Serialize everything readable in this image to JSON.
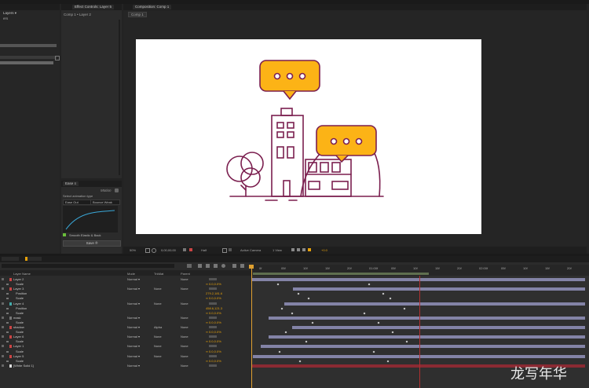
{
  "left_panel": {
    "tab_label": "Layers ▾",
    "sub_label": "ers"
  },
  "effect_panel": {
    "tab_label": "Effect Controls: Layer 5",
    "breadcrumb": "Comp 1 • Layer 2"
  },
  "ease_panel": {
    "tab_label": "Ease ≡",
    "brand": "Motion",
    "select_label": "Select animation type",
    "dropdown_1": "Ease Out",
    "dropdown_2": "Bounce Weak",
    "checkbox_label": "Smooth Elastic & Back",
    "save_button": "Save ®"
  },
  "composition": {
    "tab_label": "Composition: Comp 1",
    "comp_tab": "Comp 1",
    "footer": {
      "zoom": "50%",
      "timecode": "0;00;00;00",
      "resolution": "Half",
      "camera": "Active Camera",
      "views": "1 View",
      "exposure": "+0.0"
    }
  },
  "timeline": {
    "headers": {
      "layer_name": "Layer Name",
      "mode": "Mode",
      "trkmat": "TrkMat",
      "parent": "Parent"
    },
    "time_ticks": [
      "0f",
      "05f",
      "10f",
      "15f",
      "20f",
      "01:00f",
      "05f",
      "10f",
      "15f",
      "20f",
      "02:00f",
      "05f",
      "10f",
      "15f",
      "20f"
    ],
    "rows": [
      {
        "name": "Layer 2",
        "type": "layer",
        "mode": "Normal ▾",
        "trk": "",
        "parent": "None",
        "val": "",
        "bar": [
          320,
          745
        ],
        "bcolor": "#8383a6"
      },
      {
        "name": "Scale",
        "type": "prop",
        "mode": "",
        "trk": "",
        "parent": "",
        "val": "∞ 0.0,0.0%",
        "bar": null
      },
      {
        "name": "Layer 3",
        "type": "layer",
        "mode": "Normal ▾",
        "trk": "None",
        "parent": "None",
        "val": "",
        "bar": [
          373,
          745
        ],
        "bcolor": "#8383a6"
      },
      {
        "name": "Position",
        "type": "prop",
        "mode": "",
        "trk": "",
        "parent": "",
        "val": "279.2,181.6",
        "bar": null
      },
      {
        "name": "Scale",
        "type": "prop",
        "mode": "",
        "trk": "",
        "parent": "",
        "val": "∞ 0.0,0.0%",
        "bar": null
      },
      {
        "name": "Layer 4",
        "type": "layer",
        "mode": "Normal ▾",
        "trk": "None",
        "parent": "None",
        "val": "",
        "bar": [
          362,
          745
        ],
        "bcolor": "#8383a6"
      },
      {
        "name": "Position",
        "type": "prop",
        "mode": "",
        "trk": "",
        "parent": "",
        "val": "458.6,121.3",
        "bar": null
      },
      {
        "name": "Scale",
        "type": "prop",
        "mode": "",
        "trk": "",
        "parent": "",
        "val": "∞ 0.0,0.0%",
        "bar": null
      },
      {
        "name": "mask",
        "type": "layer",
        "mode": "Normal ▾",
        "trk": "",
        "parent": "None",
        "val": "",
        "bar": [
          342,
          745
        ],
        "bcolor": "#8383a6"
      },
      {
        "name": "Scale",
        "type": "prop",
        "mode": "",
        "trk": "",
        "parent": "",
        "val": "∞ 0.0,0.0%",
        "bar": null
      },
      {
        "name": "shadow",
        "type": "layer",
        "mode": "Normal ▾",
        "trk": "Alpha",
        "parent": "None",
        "val": "",
        "bar": [
          372,
          745
        ],
        "bcolor": "#8383a6"
      },
      {
        "name": "Scale",
        "type": "prop",
        "mode": "",
        "trk": "",
        "parent": "",
        "val": "∞ 0.0,0.0%",
        "bar": null
      },
      {
        "name": "Layer 6",
        "type": "layer",
        "mode": "Normal ▾",
        "trk": "None",
        "parent": "None",
        "val": "",
        "bar": [
          342,
          745
        ],
        "bcolor": "#8383a6"
      },
      {
        "name": "Scale",
        "type": "prop",
        "mode": "",
        "trk": "",
        "parent": "",
        "val": "∞ 0.0,0.0%",
        "bar": null
      },
      {
        "name": "Layer 1",
        "type": "layer",
        "mode": "Normal ▾",
        "trk": "None",
        "parent": "None",
        "val": "",
        "bar": [
          332,
          745
        ],
        "bcolor": "#8383a6"
      },
      {
        "name": "Scale",
        "type": "prop",
        "mode": "",
        "trk": "",
        "parent": "",
        "val": "∞ 0.0,0.0%",
        "bar": null
      },
      {
        "name": "Layer 5",
        "type": "layer",
        "mode": "Normal ▾",
        "trk": "None",
        "parent": "None",
        "val": "",
        "bar": [
          322,
          745
        ],
        "bcolor": "#8383a6"
      },
      {
        "name": "Scale",
        "type": "prop",
        "mode": "",
        "trk": "",
        "parent": "",
        "val": "∞ 0.0,0.0%",
        "bar": null
      },
      {
        "name": "[White Solid 1]",
        "type": "layer",
        "mode": "Normal ▾",
        "trk": "",
        "parent": "None",
        "val": "",
        "bar": [
          320,
          745
        ],
        "bcolor": "#8a2a33"
      }
    ]
  },
  "watermark": "龙写年华",
  "colors": {
    "accent_orange": "#fcb316",
    "illustration": "#7b1f4f",
    "layer_bar": "#8383a6",
    "solid_bar": "#8a2a33",
    "playhead": "#e0a030"
  }
}
